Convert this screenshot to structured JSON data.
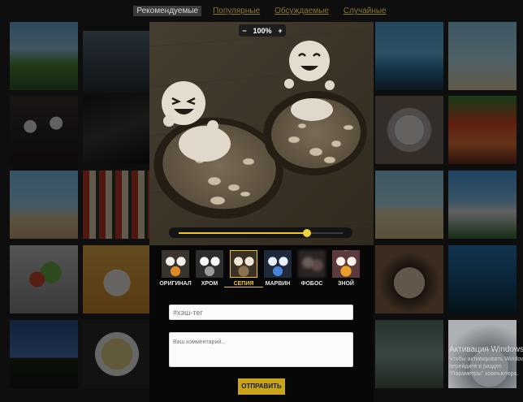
{
  "tabs": [
    {
      "label": "Рекомендуемые",
      "active": true
    },
    {
      "label": "Популярные",
      "active": false
    },
    {
      "label": "Обсуждаемые",
      "active": false
    },
    {
      "label": "Случайные",
      "active": false
    }
  ],
  "zoom": {
    "minus": "−",
    "value": "100%",
    "plus": "+"
  },
  "intensity": 0.78,
  "filters": [
    {
      "label": "ОРИГИНАЛ",
      "active": false
    },
    {
      "label": "ХРОМ",
      "active": false
    },
    {
      "label": "СЕПИЯ",
      "active": true
    },
    {
      "label": "МАРВИН",
      "active": false
    },
    {
      "label": "ФОБОС",
      "active": false
    },
    {
      "label": "ЗНОЙ",
      "active": false
    }
  ],
  "hashtag_placeholder": "#хэш-тег",
  "comment_placeholder": "Ваш комментарий...",
  "send_label": "ОТПРАВИТЬ",
  "windows_activation": {
    "title": "Активация Windows",
    "text": "Чтобы активировать Windows, перейдите в раздел \"Параметры\" компьютера."
  },
  "accent_color": "#e8c62a"
}
